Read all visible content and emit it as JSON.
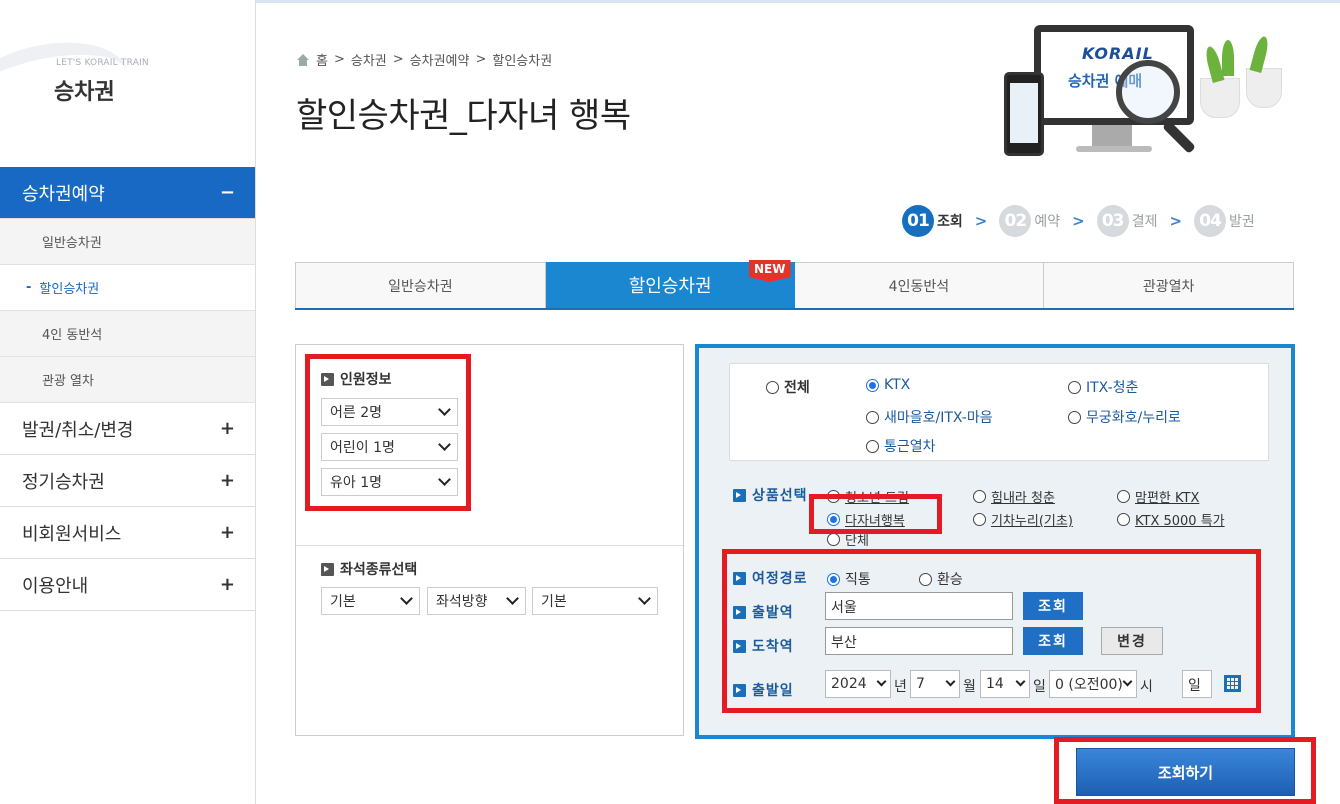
{
  "sidebar": {
    "tagline": "LET'S KORAIL TRAIN",
    "title": "승차권",
    "menus": [
      {
        "label": "승차권예약",
        "sign": "−"
      },
      {
        "label": "발권/취소/변경",
        "sign": "+"
      },
      {
        "label": "정기승차권",
        "sign": "+"
      },
      {
        "label": "비회원서비스",
        "sign": "+"
      },
      {
        "label": "이용안내",
        "sign": "+"
      }
    ],
    "submenus": [
      "일반승차권",
      "할인승차권",
      "4인 동반석",
      "관광 열차"
    ],
    "current_dash": "-"
  },
  "breadcrumb": [
    "홈",
    "승차권",
    "승차권예약",
    "할인승차권"
  ],
  "breadcrumb_sep": ">",
  "page_title": "할인승차권_다자녀 행복",
  "hero": {
    "logo": "KORAIL",
    "text": "승차권 예매"
  },
  "steps": [
    {
      "num": "01",
      "label": "조회"
    },
    {
      "num": "02",
      "label": "예약"
    },
    {
      "num": "03",
      "label": "결제"
    },
    {
      "num": "04",
      "label": "발권"
    }
  ],
  "step_arrow": ">",
  "tabs": [
    "일반승차권",
    "할인승차권",
    "4인동반석",
    "관광열차"
  ],
  "new_badge": "NEW",
  "passenger": {
    "title": "인원정보",
    "adult": "어른 2명",
    "child": "어린이 1명",
    "infant": "유아 1명"
  },
  "seat": {
    "title": "좌석종류선택",
    "type": "기본",
    "direction": "좌석방향",
    "position": "기본"
  },
  "train_types": [
    "전체",
    "KTX",
    "ITX-청춘",
    "새마을호/ITX-마음",
    "무궁화호/누리로",
    "통근열차"
  ],
  "selected_train": "KTX",
  "product": {
    "label": "상품선택",
    "options": [
      "청소년 드림",
      "힘내라 청춘",
      "맘편한 KTX",
      "다자녀행복",
      "기차누리(기초)",
      "KTX 5000 특가",
      "단체"
    ],
    "selected": "다자녀행복"
  },
  "route": {
    "label": "여정경로",
    "options": [
      "직통",
      "환승"
    ],
    "selected": "직통"
  },
  "departure": {
    "label": "출발역",
    "value": "서울",
    "button": "조회"
  },
  "arrival": {
    "label": "도착역",
    "value": "부산",
    "button": "조회",
    "change": "변경"
  },
  "date": {
    "label": "출발일",
    "year": "2024",
    "year_unit": "년",
    "month": "7",
    "month_unit": "월",
    "day": "14",
    "day_unit": "일",
    "hour": "0 (오전00)",
    "hour_unit": "시",
    "weekday": "일"
  },
  "search_button": "조회하기",
  "colors": {
    "accent": "#1b87d1",
    "sidebar_active": "#1869c4",
    "highlight": "#e51b23"
  }
}
